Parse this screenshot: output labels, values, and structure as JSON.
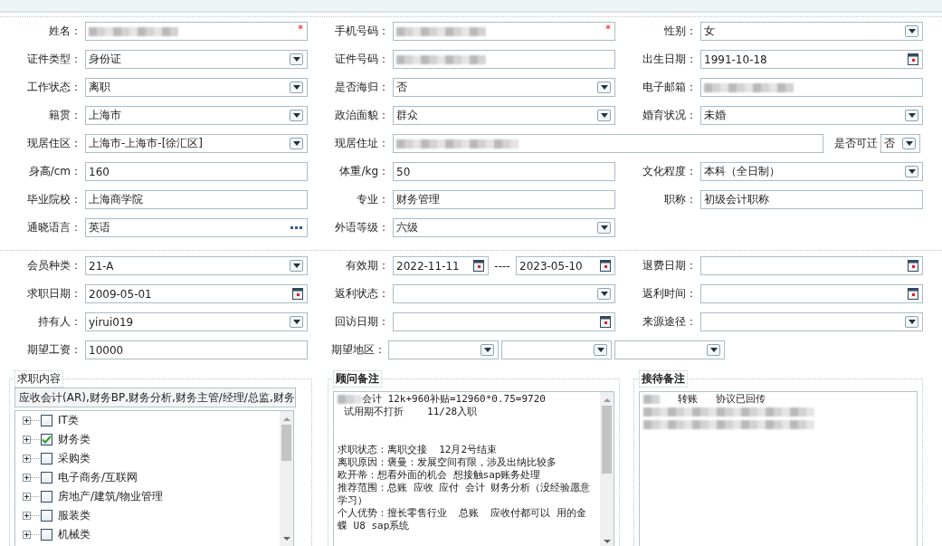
{
  "personal": [
    [
      {
        "label": "姓名：",
        "kind": "text",
        "blurred": true,
        "required_mark": "*"
      },
      {
        "label": "手机号码：",
        "kind": "text",
        "blurred": true,
        "required_mark": "*"
      },
      {
        "label": "性别：",
        "kind": "select",
        "value": "女"
      }
    ],
    [
      {
        "label": "证件类型：",
        "kind": "select",
        "value": "身份证"
      },
      {
        "label": "证件号码：",
        "kind": "text",
        "blurred": true
      },
      {
        "label": "出生日期：",
        "kind": "date",
        "value": "1991-10-18"
      }
    ],
    [
      {
        "label": "工作状态：",
        "kind": "select",
        "value": "离职"
      },
      {
        "label": "是否海归：",
        "kind": "select",
        "value": "否"
      },
      {
        "label": "电子邮箱：",
        "kind": "text",
        "blurred": true
      }
    ],
    [
      {
        "label": "籍贯：",
        "kind": "select",
        "value": "上海市"
      },
      {
        "label": "政治面貌：",
        "kind": "select",
        "value": "群众"
      },
      {
        "label": "婚育状况：",
        "kind": "select",
        "value": "未婚"
      }
    ],
    [
      {
        "label": "现居住区：",
        "kind": "select",
        "value": "上海市-上海市-[徐汇区]"
      },
      {
        "label": "现居住址：",
        "kind": "wide_text",
        "blurred": true
      },
      {
        "label": "是否可迁",
        "kind": "compact_select",
        "value": "否"
      }
    ],
    [
      {
        "label": "身高/cm：",
        "kind": "text",
        "value": "160"
      },
      {
        "label": "体重/kg：",
        "kind": "text",
        "value": "50"
      },
      {
        "label": "文化程度：",
        "kind": "select",
        "value": "本科（全日制）"
      }
    ],
    [
      {
        "label": "毕业院校：",
        "kind": "text",
        "value": "上海商学院"
      },
      {
        "label": "专业：",
        "kind": "text",
        "value": "财务管理"
      },
      {
        "label": "职称：",
        "kind": "text",
        "value": "初级会计职称"
      }
    ],
    [
      {
        "label": "通晓语言：",
        "kind": "lookup",
        "value": "英语"
      },
      {
        "label": "外语等级：",
        "kind": "select",
        "value": "六级"
      }
    ]
  ],
  "membership": [
    [
      {
        "label": "会员种类：",
        "kind": "select",
        "value": "21-A"
      },
      {
        "label": "有效期：",
        "kind": "date_range",
        "value": "2022-11-11",
        "separator": "----",
        "value_end": "2023-05-10"
      },
      {
        "label": "退费日期：",
        "kind": "date"
      }
    ],
    [
      {
        "label": "求职日期：",
        "kind": "date",
        "value": "2009-05-01"
      },
      {
        "label": "返利状态：",
        "kind": "select"
      },
      {
        "label": "返利时间：",
        "kind": "date"
      }
    ],
    [
      {
        "label": "持有人：",
        "kind": "select",
        "value": "yirui019"
      },
      {
        "label": "回访日期：",
        "kind": "date"
      },
      {
        "label": "来源途径：",
        "kind": "select"
      }
    ],
    [
      {
        "label": "期望工资：",
        "kind": "text",
        "value": "10000"
      },
      {
        "label": "期望地区：",
        "kind": "region"
      }
    ]
  ],
  "job_intent": {
    "title": "求职内容",
    "summary": "应收会计(AR),财务BP,财务分析,财务主管/经理/总监,财务",
    "categories": [
      {
        "label": "IT类",
        "checked": false,
        "expanded": false
      },
      {
        "label": "财务类",
        "checked": true,
        "expanded": false
      },
      {
        "label": "采购类",
        "checked": false,
        "expanded": false
      },
      {
        "label": "电子商务/互联网",
        "checked": false,
        "expanded": false
      },
      {
        "label": "房地产/建筑/物业管理",
        "checked": false,
        "expanded": false
      },
      {
        "label": "服装类",
        "checked": false,
        "expanded": false
      },
      {
        "label": "机械类",
        "checked": false,
        "expanded": false
      }
    ]
  },
  "consultant_note": {
    "title": "顾问备注",
    "lines": [
      {
        "kind": "text",
        "blurred_prefix": true,
        "text": "会计 12k+960补贴=12960*0.75=9720"
      },
      {
        "kind": "text",
        "text": " 试用期不打折    11/28入职"
      },
      {
        "kind": "blank"
      },
      {
        "kind": "blank"
      },
      {
        "kind": "text",
        "text": "求职状态：离职交接  12月2号结束"
      },
      {
        "kind": "text",
        "text": "离职原因：褒曼：发展空间有限，涉及出纳比较多"
      },
      {
        "kind": "text",
        "text": "欧开蒂：想看外面的机会 想接触sap账务处理"
      },
      {
        "kind": "text",
        "text": "推荐范围：总账 应收 应付 会计 财务分析（没经验愿意学习）"
      },
      {
        "kind": "text",
        "text": "个人优势：擅长零售行业  总账  应收付都可以 用的金蝶 U8 sap系统"
      }
    ]
  },
  "reception_note": {
    "title": "接待备注",
    "lines": [
      {
        "kind": "text",
        "blurred_prefix": true,
        "text": "   转账   协议已回传"
      },
      {
        "kind": "blurred"
      },
      {
        "kind": "blurred"
      }
    ]
  }
}
